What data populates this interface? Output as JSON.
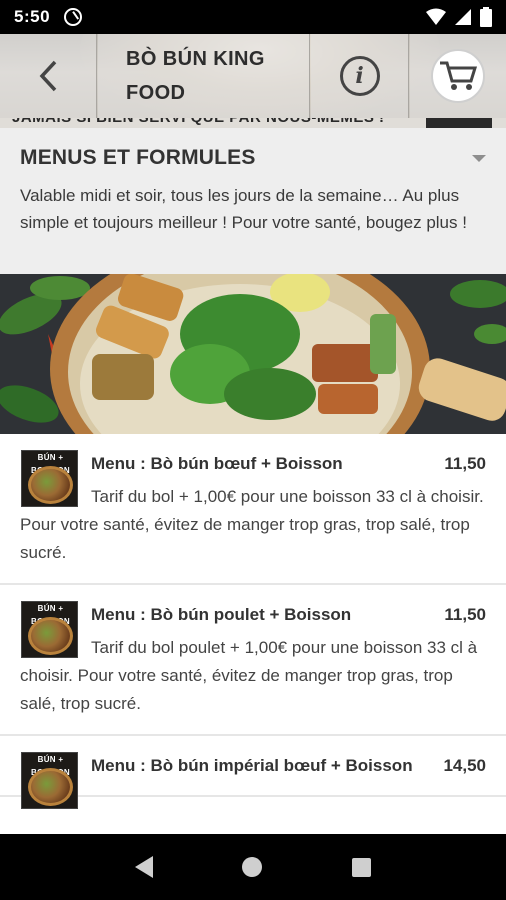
{
  "status_bar": {
    "time": "5:50"
  },
  "header": {
    "title": "BÒ BÚN KING FOOD"
  },
  "banner": {
    "text": "JAMAIS SI BIEN SERVI QUE PAR NOUS-MÊMES !"
  },
  "section": {
    "title": "MENUS ET FORMULES",
    "description": "Valable midi et soir, tous les jours de la semaine… Au plus simple et toujours meilleur ! Pour votre santé, bougez plus !"
  },
  "items": [
    {
      "name": "Menu : Bò bún bœuf + Boisson",
      "price": "11,50",
      "description": "Tarif du bol + 1,00€ pour une boisson 33 cl à choisir. Pour votre santé, évitez de manger trop gras, trop salé, trop sucré.",
      "thumb_label": "BÚN + BOISSON"
    },
    {
      "name": "Menu : Bò bún poulet + Boisson",
      "price": "11,50",
      "description": "Tarif du bol poulet + 1,00€ pour une boisson 33 cl à choisir. Pour votre santé, évitez de manger trop gras, trop salé, trop sucré.",
      "thumb_label": "BÚN + BOISSON"
    },
    {
      "name": "Menu : Bò bún impérial bœuf + Boisson",
      "price": "14,50",
      "description": "",
      "thumb_label": "BÚN + BOISSON"
    }
  ],
  "icons": {
    "back": "chevron-left-icon",
    "info": "info-icon",
    "cart": "shopping-cart-icon",
    "dropdown": "caret-down-icon",
    "nav_back": "triangle-back-icon",
    "nav_home": "circle-home-icon",
    "nav_recent": "square-recent-icon"
  },
  "colors": {
    "header_bg": "#c9c5be",
    "section_bg": "#eeeeee",
    "text": "#333333"
  }
}
